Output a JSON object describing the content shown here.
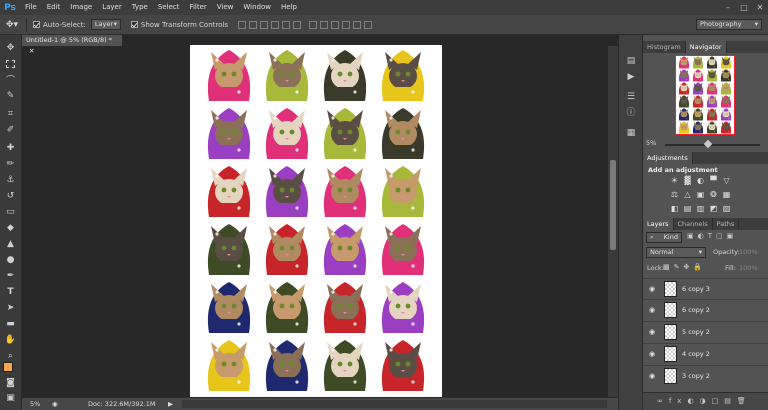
{
  "app": {
    "logo": "Ps"
  },
  "menu": [
    "File",
    "Edit",
    "Image",
    "Layer",
    "Type",
    "Select",
    "Filter",
    "View",
    "Window",
    "Help"
  ],
  "window_controls": [
    "–",
    "□",
    "✕"
  ],
  "options": {
    "auto_select_label": "Auto-Select:",
    "auto_select_value": "Layer",
    "show_transform_label": "Show Transform Controls",
    "workspace": "Photography"
  },
  "document": {
    "tab_title": "Untitled-1 @ 5% (RGB/8) *",
    "zoom": "5%",
    "doc_size": "Doc: 322.6M/392.1M"
  },
  "panels": {
    "top_tabs": [
      "Histogram",
      "Navigator"
    ],
    "navigator_zoom": "5%",
    "adjustments_tab": "Adjustments",
    "adjustments_heading": "Add an adjustment",
    "layer_tabs": [
      "Layers",
      "Channels",
      "Paths"
    ],
    "kind_label": "Kind",
    "blend_mode": "Normal",
    "opacity_label": "Opacity:",
    "opacity_value": "100%",
    "lock_label": "Lock:",
    "fill_label": "Fill:",
    "fill_value": "100%"
  },
  "layers": [
    "6 copy 3",
    "6 copy 2",
    "5 copy 2",
    "4 copy 2",
    "3 copy 2"
  ]
}
